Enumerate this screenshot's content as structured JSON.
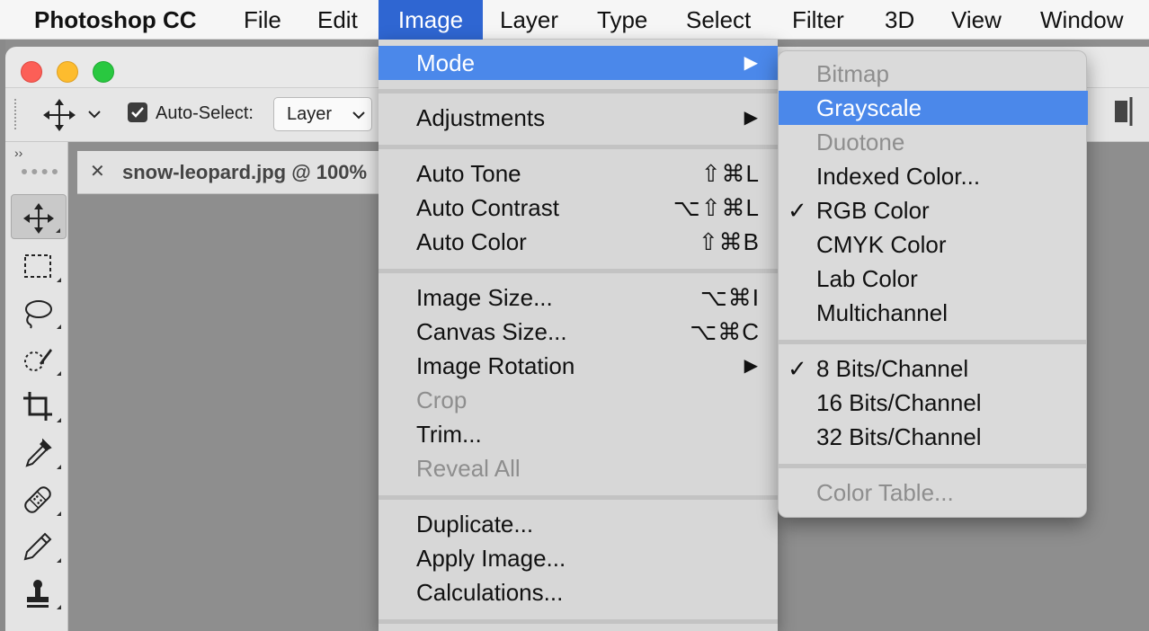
{
  "menubar": {
    "app": "Photoshop CC",
    "items": [
      "File",
      "Edit",
      "Image",
      "Layer",
      "Type",
      "Select",
      "Filter",
      "3D",
      "View",
      "Window"
    ]
  },
  "options": {
    "auto_select_label": "Auto-Select:",
    "auto_select_value": "Layer",
    "auto_select_checked": true
  },
  "toolbar": {
    "collapse_label": "››"
  },
  "document": {
    "tab_title": "snow-leopard.jpg @ 100%",
    "close_label": "✕"
  },
  "image_menu": {
    "items": [
      {
        "label": "Mode",
        "arrow": "▶",
        "highlighted": true
      },
      {
        "label": "Adjustments",
        "arrow": "▶"
      },
      {
        "label": "Auto Tone",
        "shortcut": "⇧⌘L"
      },
      {
        "label": "Auto Contrast",
        "shortcut": "⌥⇧⌘L"
      },
      {
        "label": "Auto Color",
        "shortcut": "⇧⌘B"
      },
      {
        "label": "Image Size...",
        "shortcut": "⌥⌘I"
      },
      {
        "label": "Canvas Size...",
        "shortcut": "⌥⌘C"
      },
      {
        "label": "Image Rotation",
        "arrow": "▶"
      },
      {
        "label": "Crop",
        "disabled": true
      },
      {
        "label": "Trim..."
      },
      {
        "label": "Reveal All",
        "disabled": true
      },
      {
        "label": "Duplicate..."
      },
      {
        "label": "Apply Image..."
      },
      {
        "label": "Calculations..."
      }
    ]
  },
  "mode_submenu": {
    "items": [
      {
        "label": "Bitmap",
        "disabled": true
      },
      {
        "label": "Grayscale",
        "highlighted": true
      },
      {
        "label": "Duotone",
        "disabled": true
      },
      {
        "label": "Indexed Color..."
      },
      {
        "label": "RGB Color",
        "checked": true
      },
      {
        "label": "CMYK Color"
      },
      {
        "label": "Lab Color"
      },
      {
        "label": "Multichannel"
      },
      {
        "label": "8 Bits/Channel",
        "checked": true
      },
      {
        "label": "16 Bits/Channel"
      },
      {
        "label": "32 Bits/Channel"
      },
      {
        "label": "Color Table...",
        "disabled": true
      }
    ],
    "check_glyph": "✓"
  },
  "colors": {
    "menubar_active": "#2f66d2",
    "menu_highlight": "#4b88ea"
  }
}
